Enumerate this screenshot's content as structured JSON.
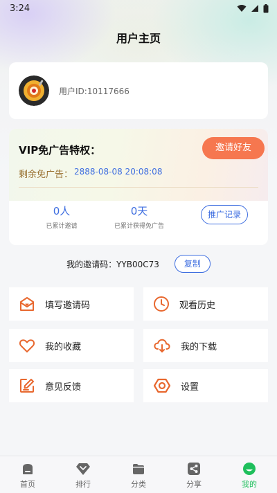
{
  "status_bar": {
    "time": "3:24"
  },
  "header": {
    "title": "用户主页"
  },
  "profile": {
    "user_id": "用户ID:10117666"
  },
  "vip": {
    "title": "VIP免广告特权：",
    "remaining_label": "剩余免广告：",
    "remaining_value": "2888-08-08 20:08:08",
    "invite_button": "邀请好友",
    "stats": [
      {
        "value": "0人",
        "label": "已累计邀请"
      },
      {
        "value": "0天",
        "label": "已累计获得免广告"
      }
    ],
    "promo_button": "推广记录"
  },
  "invite": {
    "code_text": "我的邀请码：YYB00C73",
    "copy_button": "复制"
  },
  "menu": [
    {
      "label": "填写邀请码",
      "icon": "envelope-heart-icon"
    },
    {
      "label": "观看历史",
      "icon": "clock-icon"
    },
    {
      "label": "我的收藏",
      "icon": "heart-icon"
    },
    {
      "label": "我的下载",
      "icon": "cloud-download-icon"
    },
    {
      "label": "意见反馈",
      "icon": "edit-icon"
    },
    {
      "label": "设置",
      "icon": "settings-hex-icon"
    }
  ],
  "nav": {
    "items": [
      {
        "label": "首页",
        "icon": "home-icon"
      },
      {
        "label": "排行",
        "icon": "diamond-icon"
      },
      {
        "label": "分类",
        "icon": "folder-icon"
      },
      {
        "label": "分享",
        "icon": "share-icon"
      },
      {
        "label": "我的",
        "icon": "profile-smile-icon"
      }
    ],
    "active_index": 4
  },
  "colors": {
    "accent_orange": "#f6774f",
    "accent_blue": "#3e6ee0",
    "active_green": "#1fbf5c",
    "menu_icon": "#e8682f"
  }
}
